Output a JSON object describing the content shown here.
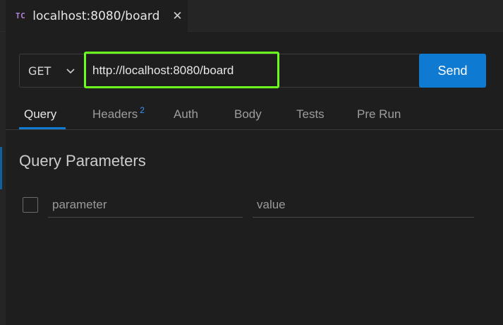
{
  "tab": {
    "icon": "TC",
    "title": "localhost:8080/board",
    "close": "✕"
  },
  "request": {
    "method": "GET",
    "url": "http://localhost:8080/board",
    "send_label": "Send"
  },
  "tabs": [
    {
      "label": "Query",
      "active": true
    },
    {
      "label": "Headers",
      "badge": "2"
    },
    {
      "label": "Auth"
    },
    {
      "label": "Body"
    },
    {
      "label": "Tests"
    },
    {
      "label": "Pre Run"
    }
  ],
  "query": {
    "title": "Query Parameters",
    "param_placeholder": "parameter",
    "value_placeholder": "value"
  },
  "colors": {
    "accent": "#0e7ad1",
    "highlight": "#6cff1e",
    "badge": "#3794ff"
  }
}
